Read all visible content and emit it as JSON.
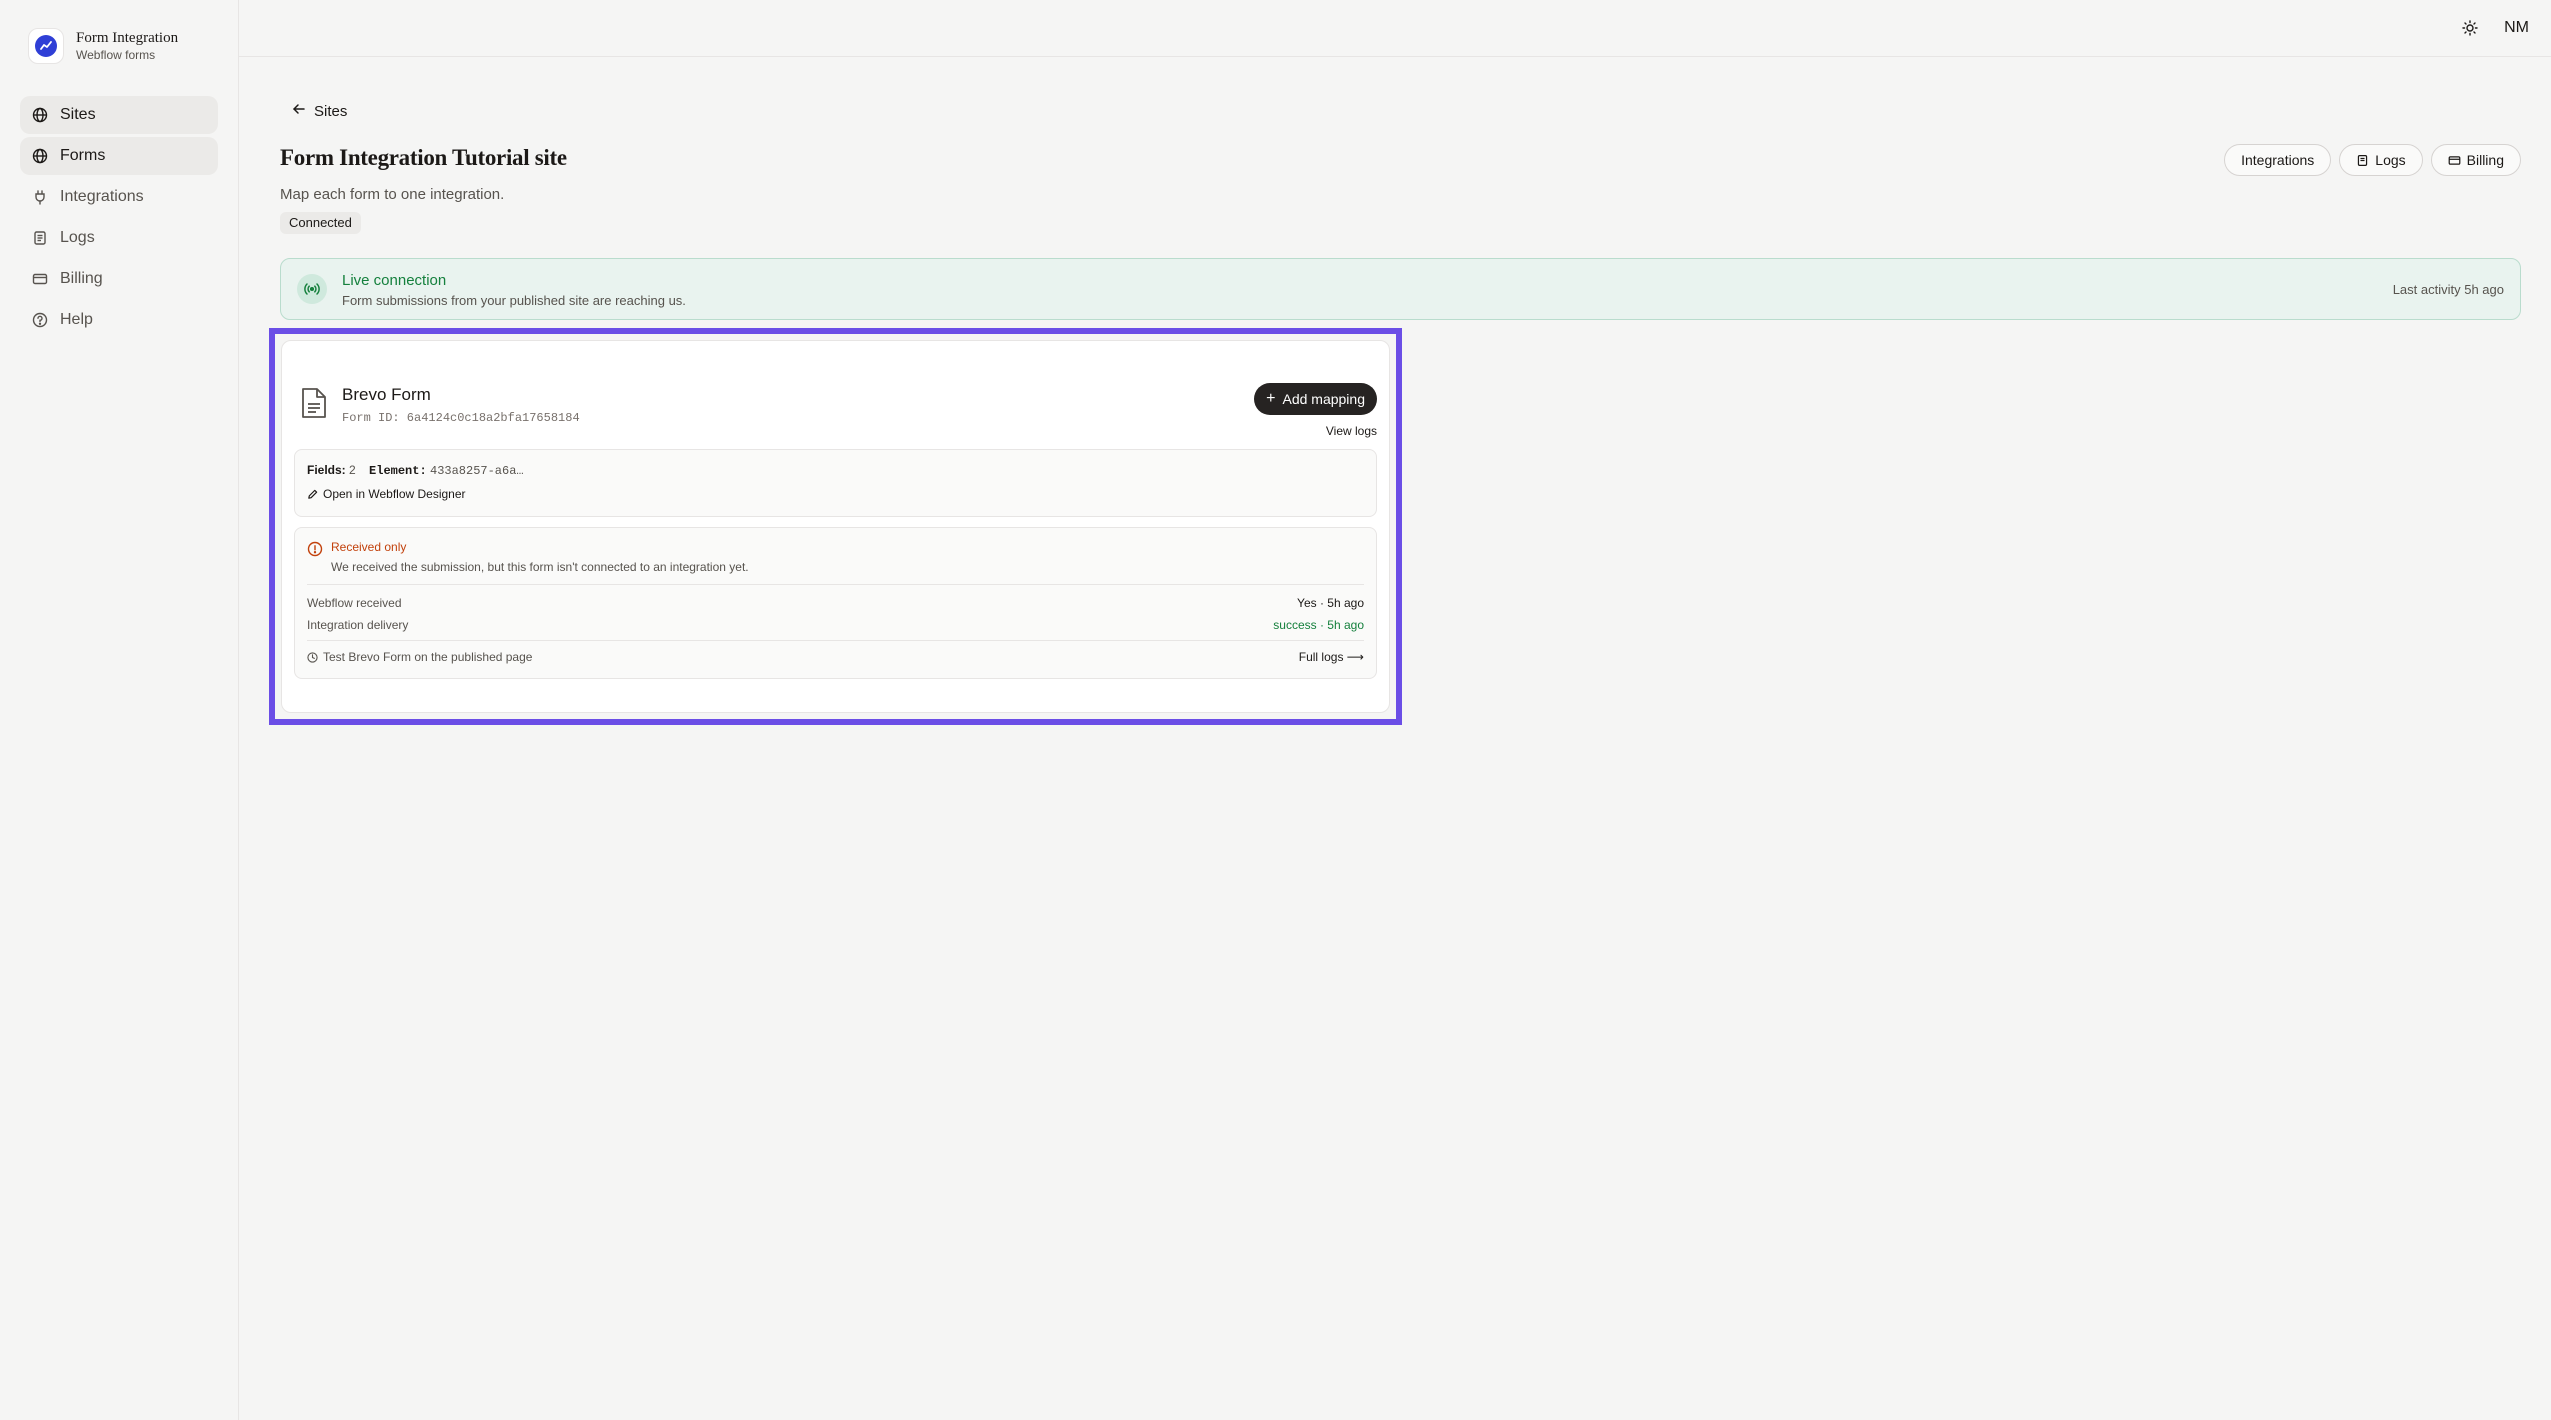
{
  "brand": {
    "title": "Form Integration",
    "subtitle": "Webflow forms"
  },
  "sidebar": {
    "items": [
      {
        "label": "Sites",
        "icon": "globe-icon",
        "active": true
      },
      {
        "label": "Forms",
        "icon": "globe-icon",
        "active": true
      },
      {
        "label": "Integrations",
        "icon": "plug-icon",
        "active": false
      },
      {
        "label": "Logs",
        "icon": "scroll-icon",
        "active": false
      },
      {
        "label": "Billing",
        "icon": "credit-card-icon",
        "active": false
      },
      {
        "label": "Help",
        "icon": "help-circle-icon",
        "active": false
      }
    ]
  },
  "topbar": {
    "user_initials": "NM",
    "theme_icon": "sun-icon"
  },
  "header": {
    "back_label": "Sites",
    "title": "Form Integration Tutorial site",
    "subtitle": "Map each form to one integration.",
    "status": "Connected",
    "actions": {
      "integrations": "Integrations",
      "logs": "Logs",
      "billing": "Billing"
    }
  },
  "live": {
    "title": "Live connection",
    "description": "Form submissions from your published site are reaching us.",
    "last_activity": "Last activity 5h ago"
  },
  "form": {
    "name": "Brevo Form",
    "id_text": "Form ID: 6a4124c0c18a2bfa17658184",
    "add_mapping": "Add mapping",
    "view_logs": "View logs",
    "fields_label": "Fields:",
    "fields_value": "2",
    "element_label": "Element:",
    "element_value": "433a8257-a6a…",
    "open_designer": "Open in Webflow Designer",
    "status": {
      "title": "Received only",
      "description": "We received the submission, but this form isn't connected to an integration yet.",
      "webflow_label": "Webflow received",
      "webflow_value": "Yes · 5h ago",
      "delivery_label": "Integration delivery",
      "delivery_value": "success · 5h ago",
      "test_text": "Test Brevo Form on the published page",
      "full_logs": "Full logs ⟶"
    }
  },
  "colors": {
    "accent_highlight": "#6b4ee6",
    "success": "#15803d",
    "warning": "#c2410c",
    "brand": "#2f3fd6"
  }
}
